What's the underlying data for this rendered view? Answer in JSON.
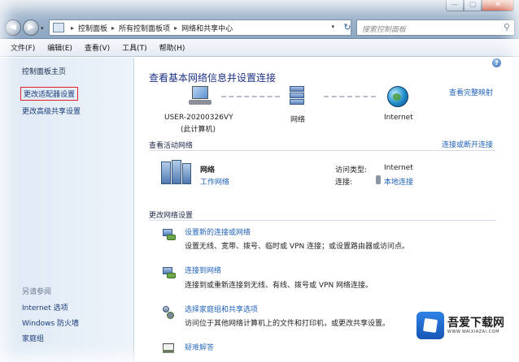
{
  "window": {
    "controls": {
      "minimize": "—",
      "maximize": "▢",
      "close": "✕"
    }
  },
  "nav": {
    "back_glyph": "◀",
    "forward_glyph": "▶",
    "dropdown_glyph": "▾"
  },
  "address": {
    "separator": "▸",
    "crumbs": [
      "控制面板",
      "所有控制面板项",
      "网络和共享中心"
    ],
    "dropdown_glyph": "▾",
    "refresh_glyph": "↻"
  },
  "search": {
    "placeholder": "搜索控制面板",
    "icon": "search-icon",
    "glyph": "⚲"
  },
  "menu": [
    "文件(F)",
    "编辑(E)",
    "查看(V)",
    "工具(T)",
    "帮助(H)"
  ],
  "sidebar": {
    "home": "控制面板主页",
    "links": [
      "更改适配器设置",
      "更改高级共享设置"
    ],
    "see_also_title": "另请参阅",
    "see_also": [
      "Internet 选项",
      "Windows 防火墙",
      "家庭组"
    ]
  },
  "help_glyph": "?",
  "main": {
    "title": "查看基本网络信息并设置连接",
    "view_full_map": "查看完整映射",
    "map": {
      "computer_name": "USER-20200326VY",
      "computer_sub": "(此计算机)",
      "network_label": "网络",
      "internet_label": "Internet"
    },
    "active_networks": {
      "title": "查看活动网络",
      "connect_or_disconnect": "连接或断开连接",
      "network_name": "网络",
      "network_type": "工作网络",
      "access_type_label": "访问类型:",
      "access_type_value": "Internet",
      "connections_label": "连接:",
      "connections_value": "本地连接"
    },
    "change_settings": {
      "title": "更改网络设置",
      "tasks": [
        {
          "link": "设置新的连接或网络",
          "desc": "设置无线、宽带、拨号、临时或 VPN 连接；或设置路由器或访问点。"
        },
        {
          "link": "连接到网络",
          "desc": "连接到或重新连接到无线、有线、拨号或 VPN 网络连接。"
        },
        {
          "link": "选择家庭组和共享选项",
          "desc": "访问位于其他网络计算机上的文件和打印机，或更改共享设置。"
        },
        {
          "link": "疑难解答",
          "desc": ""
        }
      ]
    }
  },
  "watermark": {
    "name": "吾爱下载网",
    "sub": "WWW.WAIXIAZAI.COM"
  },
  "colors": {
    "link": "#1f62b8",
    "title": "#1e3287",
    "highlight_border": "#e0202a"
  }
}
